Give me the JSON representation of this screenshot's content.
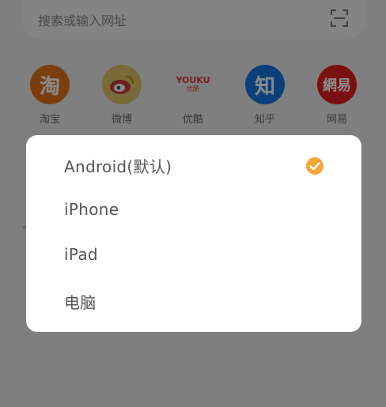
{
  "search": {
    "placeholder": "搜索或输入网址"
  },
  "shortcuts": [
    {
      "label": "淘宝",
      "icon": "taobao-icon",
      "glyph": "淘",
      "color": "#7a3f0c"
    },
    {
      "label": "微博",
      "icon": "weibo-icon",
      "color": "#7a6a3a"
    },
    {
      "label": "优酷",
      "icon": "youku-icon",
      "glyph_top": "YOUKU",
      "glyph_bottom": "优酷",
      "color": "#7e7e7e"
    },
    {
      "label": "知乎",
      "icon": "zhihu-icon",
      "glyph": "知",
      "color": "#0b3f7a"
    },
    {
      "label": "网易",
      "icon": "netease-icon",
      "glyph": "網易",
      "color": "#7a1010"
    }
  ],
  "dialog": {
    "options": [
      {
        "label": "Android(默认)",
        "selected": true
      },
      {
        "label": "iPhone",
        "selected": false
      },
      {
        "label": "iPad",
        "selected": false
      },
      {
        "label": "电脑",
        "selected": false
      }
    ],
    "accent_color": "#f5a53c"
  }
}
